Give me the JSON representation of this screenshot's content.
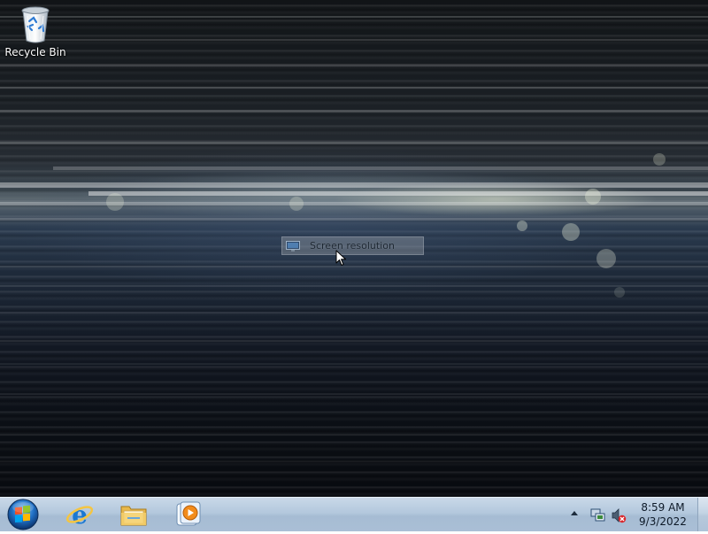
{
  "desktop": {
    "icons": [
      {
        "label": "Recycle Bin",
        "icon": "recycle-bin-icon"
      }
    ]
  },
  "context_menu": {
    "items": [
      {
        "label": "Screen resolution",
        "icon": "display-icon"
      }
    ]
  },
  "taskbar": {
    "start_icon": "windows-start-orb-icon",
    "pinned": [
      {
        "name": "internet-explorer",
        "icon": "internet-explorer-icon"
      },
      {
        "name": "windows-explorer",
        "icon": "folder-icon"
      },
      {
        "name": "media-player",
        "icon": "media-player-icon"
      }
    ],
    "tray": {
      "show_hidden_icon": "chevron-up-icon",
      "network_icon": "network-icon",
      "volume_icon": "volume-muted-icon",
      "time": "8:59 AM",
      "date": "9/3/2022"
    }
  },
  "colors": {
    "taskbar": "#b3c8dd",
    "menu_highlight": "#c8cdd2",
    "start_orb_blue": "#1f6fc4"
  }
}
